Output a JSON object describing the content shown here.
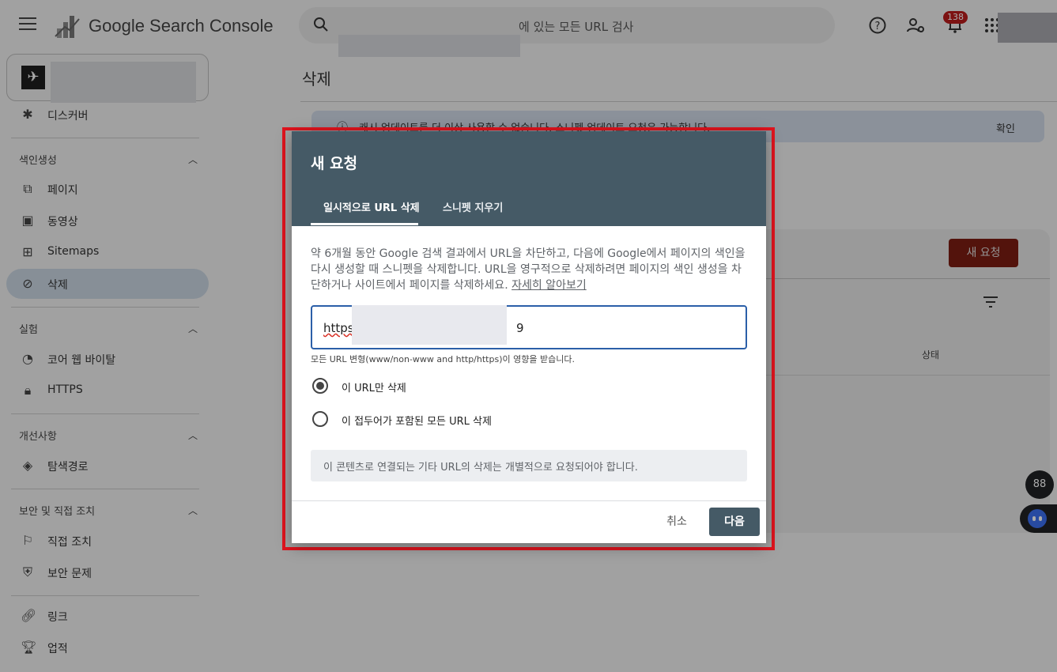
{
  "app": {
    "title": "Google Search Console"
  },
  "search": {
    "placeholder": "에 있는 모든 URL 검사"
  },
  "header": {
    "notification_count": "138"
  },
  "sidebar": {
    "items": [
      {
        "label": "디스커버",
        "icon": "asterisk-icon"
      },
      {
        "label": "페이지",
        "icon": "pages-icon"
      },
      {
        "label": "동영상",
        "icon": "video-icon"
      },
      {
        "label": "Sitemaps",
        "icon": "sitemap-icon"
      },
      {
        "label": "삭제",
        "icon": "eye-off-icon"
      },
      {
        "label": "코어 웹 바이탈",
        "icon": "speedometer-icon"
      },
      {
        "label": "HTTPS",
        "icon": "lock-icon"
      },
      {
        "label": "탐색경로",
        "icon": "layers-icon"
      },
      {
        "label": "직접 조치",
        "icon": "flag-icon"
      },
      {
        "label": "보안 문제",
        "icon": "shield-icon"
      },
      {
        "label": "링크",
        "icon": "link-icon"
      },
      {
        "label": "업적",
        "icon": "trophy-icon"
      }
    ],
    "sections": [
      "색인생성",
      "실험",
      "개선사항",
      "보안 및 직접 조치"
    ]
  },
  "main": {
    "title": "삭제",
    "banner_text": "캐시 업데이트를 더 이상 사용할 수 없습니다. 스니펫 업데이트 요청은 가능합니다.",
    "banner_action": "확인",
    "new_request_label": "새 요청",
    "status_column": "상태"
  },
  "dialog": {
    "title": "새 요청",
    "tabs": [
      "일시적으로 URL 삭제",
      "스니펫 지우기"
    ],
    "description": "약 6개월 동안 Google 검색 결과에서 URL을 차단하고, 다음에 Google에서 페이지의 색인을 다시 생성할 때 스니펫을 삭제합니다. URL을 영구적으로 삭제하려면 페이지의 색인 생성을 차단하거나 사이트에서 페이지를 삭제하세요.",
    "learn_more": "자세히 알아보기",
    "url_value_prefix": "https",
    "url_value_suffix": "9",
    "helper_text": "모든 URL 변형(www/non-www and http/https)이 영향을 받습니다.",
    "options": [
      {
        "label": "이 URL만 삭제",
        "checked": true
      },
      {
        "label": "이 접두어가 포함된 모든 URL 삭제",
        "checked": false
      }
    ],
    "note": "이 콘텐츠로 연결되는 기타 URL의 삭제는 개별적으로 요청되어야 합니다.",
    "cancel_label": "취소",
    "next_label": "다음"
  },
  "fab": {
    "assist_label": "88"
  },
  "colors": {
    "highlight": "#e0141e",
    "dialog_header": "#455a66",
    "primary_button": "#455a66",
    "danger_button": "#7c1d12",
    "input_focus": "#2b5fa8"
  }
}
